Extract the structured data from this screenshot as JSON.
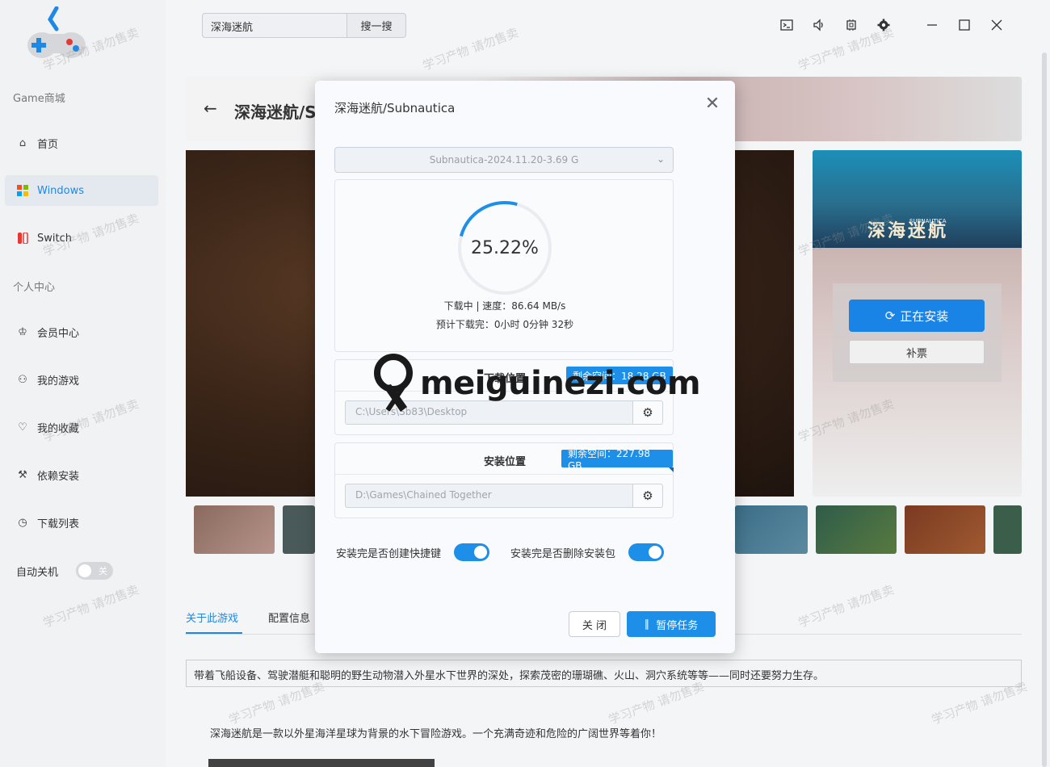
{
  "sidebar": {
    "section_store": "Game商城",
    "section_personal": "个人中心",
    "items": [
      {
        "label": "首页",
        "icon": "home-icon"
      },
      {
        "label": "Windows",
        "icon": "windows-icon"
      },
      {
        "label": "Switch",
        "icon": "switch-icon"
      },
      {
        "label": "会员中心",
        "icon": "vip-icon"
      },
      {
        "label": "我的游戏",
        "icon": "user-games-icon"
      },
      {
        "label": "我的收藏",
        "icon": "heart-icon"
      },
      {
        "label": "依赖安装",
        "icon": "wrench-icon"
      },
      {
        "label": "下载列表",
        "icon": "download-clock-icon"
      }
    ],
    "auto_shutdown": {
      "label": "自动关机",
      "toggle_label": "关",
      "on": false
    }
  },
  "topbar": {
    "search_value": "深海迷航",
    "search_button": "搜一搜"
  },
  "background": {
    "game_title": "深海迷航/S",
    "cover_logo": "深海迷航",
    "cover_sub": "SUBNAUTICA",
    "installing_button": "正在安装",
    "ticket_button": "补票",
    "tabs": [
      "关于此游戏",
      "配置信息"
    ],
    "summary": "带着飞船设备、驾驶潜艇和聪明的野生动物潜入外星水下世界的深处，探索茂密的珊瑚礁、火山、洞穴系统等等——同时还要努力生存。",
    "description": "深海迷航是一款以外星海洋星球为背景的水下冒险游戏。一个充满奇迹和危险的广阔世界等着你！",
    "watermark_faint": "学习产物 请勿售卖"
  },
  "dialog": {
    "title": "深海迷航/Subnautica",
    "version": "Subnautica-2024.11.20-3.69 G",
    "progress_percent": 25.22,
    "progress_text": "25.22%",
    "status": "下载中 | 速度：86.64 MB/s",
    "eta": "预计下载完：0小时 0分钟 32秒",
    "download": {
      "title": "下载位置",
      "space": "剩余空间：18.28 GB",
      "path": "C:\\Users\\Sb83\\Desktop"
    },
    "install": {
      "title": "安装位置",
      "space": "剩余空间：227.98 GB",
      "path": "D:\\Games\\Chained Together"
    },
    "opt_shortcut": "安装完是否创建快捷键",
    "opt_delete": "安装完是否删除安装包",
    "btn_close": "关 闭",
    "btn_pause": "暂停任务"
  },
  "watermark": "meiguinezi.com",
  "colors": {
    "accent": "#1e8fe8"
  }
}
